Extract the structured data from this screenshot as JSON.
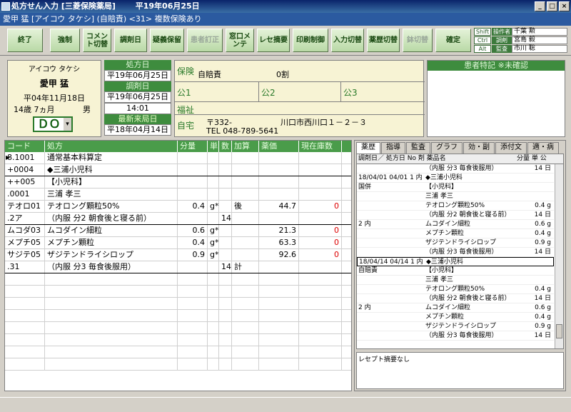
{
  "window": {
    "title": "処方せん入力 [三菱保険薬局]",
    "date": "平19年06月25日",
    "btn_min": "_",
    "btn_max": "□",
    "btn_close": "×"
  },
  "info_bar": "愛甲 猛 [アイコウ タケシ] (自賠責) <31> 複数保険あり",
  "toolbar": [
    {
      "label": "終了",
      "enabled": true
    },
    {
      "label": "強制",
      "enabled": true
    },
    {
      "label": "コメント切替",
      "enabled": true
    },
    {
      "label": "調剤日",
      "enabled": true
    },
    {
      "label": "疑義保留",
      "enabled": true
    },
    {
      "label": "患者訂正",
      "enabled": false
    },
    {
      "label": "窓口メンテ",
      "enabled": true
    },
    {
      "label": "レセ摘要",
      "enabled": true
    },
    {
      "label": "印刷制御",
      "enabled": true
    },
    {
      "label": "入力切替",
      "enabled": true
    },
    {
      "label": "薬歴切替",
      "enabled": true
    },
    {
      "label": "鉢切替",
      "enabled": false
    },
    {
      "label": "確定",
      "enabled": true
    }
  ],
  "keys": [
    {
      "key": "Shift",
      "name": "操作者",
      "value": "千葉 勲"
    },
    {
      "key": "Ctrl",
      "name": "調剤",
      "value": "宮島 毅"
    },
    {
      "key": "Alt",
      "name": "監査",
      "value": "市川 聡"
    }
  ],
  "patient": {
    "kana": "アイコウ タケシ",
    "name": "愛甲 猛",
    "birth": "平04年11月18日",
    "age": "14歳 7ヵ月",
    "sex": "男",
    "do_label": "ＤＯ",
    "do_arrow": "▾"
  },
  "dates": {
    "rx_label": "処方日",
    "rx_value": "平19年06月25日",
    "disp_label": "調剤日",
    "disp_value": "平19年06月25日",
    "disp_time": "14:01",
    "last_label": "最新来局日",
    "last_value": "平18年04月14日"
  },
  "insurance": {
    "hoken_label": "保険",
    "hoken_value": "自賠責",
    "ratio": "0割",
    "kou1": "公1",
    "kou2": "公2",
    "kou3": "公3",
    "fukushi": "福祉",
    "home_label": "自宅",
    "postal": "〒332-",
    "address": "川口市西川口１－２－３",
    "tel": "TEL 048-789-5641"
  },
  "notes_header": "患者特記 ※未確認",
  "rx_grid": {
    "headers": [
      "コード",
      "処方",
      "分量",
      "単",
      "数",
      "加算",
      "薬価",
      "現在庫数"
    ],
    "rows": [
      {
        "code": "8.1001",
        "name": "通常基本料算定",
        "qty": "",
        "unit": "",
        "n": "",
        "add": "",
        "price": "",
        "stock": "",
        "sep": false
      },
      {
        "code": "+0004",
        "name": "◆三浦小児科",
        "qty": "",
        "unit": "",
        "n": "",
        "add": "",
        "price": "",
        "stock": "",
        "sep": true
      },
      {
        "code": "++005",
        "name": "【小児科】",
        "qty": "",
        "unit": "",
        "n": "",
        "add": "",
        "price": "",
        "stock": "",
        "sep": false
      },
      {
        "code": ".0001",
        "name": "三浦 孝三",
        "qty": "",
        "unit": "",
        "n": "",
        "add": "",
        "price": "",
        "stock": "",
        "sep": false
      },
      {
        "code": "テオロ01",
        "name": "テオロング顆粒50%",
        "qty": "0.4",
        "unit": "g*",
        "n": "",
        "add": "後",
        "price": "44.7",
        "stock": "0",
        "sep": false
      },
      {
        "code": ".2ア",
        "name": "（内服 分2 朝食後と寝る前）",
        "qty": "",
        "unit": "",
        "n": "14",
        "add": "",
        "price": "",
        "stock": "",
        "sep": true
      },
      {
        "code": "ムコダ03",
        "name": "ムコダイン細粒",
        "qty": "0.6",
        "unit": "g*",
        "n": "",
        "add": "",
        "price": "21.3",
        "stock": "0",
        "sep": false
      },
      {
        "code": "メプチ05",
        "name": "メプチン顆粒",
        "qty": "0.4",
        "unit": "g*",
        "n": "",
        "add": "",
        "price": "63.3",
        "stock": "0",
        "sep": false
      },
      {
        "code": "サジテ05",
        "name": "ザジテンドライシロップ",
        "qty": "0.9",
        "unit": "g*",
        "n": "",
        "add": "",
        "price": "92.6",
        "stock": "0",
        "sep": false
      },
      {
        "code": ".31",
        "name": "（内服 分3 毎食後服用）",
        "qty": "",
        "unit": "",
        "n": "14",
        "add": "計",
        "price": "",
        "stock": "",
        "sep": true
      }
    ]
  },
  "history": {
    "tabs": [
      "薬歴",
      "指導",
      "監査",
      "グラフ",
      "効・副",
      "添付文",
      "適・病"
    ],
    "headers": [
      "調剤日／ 処方日 No 剤 薬品名",
      "分量 単 公"
    ],
    "rows": [
      {
        "a": "",
        "b": "（内服 分3 毎食後服用）",
        "c": "14 日",
        "sel": false
      },
      {
        "a": "18/04/01  04/01  1 内",
        "b": "◆三浦小児科",
        "c": "",
        "sel": false
      },
      {
        "a": "国併",
        "b": "【小児科】",
        "c": "",
        "sel": false
      },
      {
        "a": "",
        "b": "三浦 孝三",
        "c": "",
        "sel": false
      },
      {
        "a": "",
        "b": "テオロング顆粒50%",
        "c": "0.4 g",
        "sel": false
      },
      {
        "a": "",
        "b": "（内服 分2 朝食後と寝る前）",
        "c": "14 日",
        "sel": false
      },
      {
        "a": "2 内",
        "b": "ムコダイン細粒",
        "c": "0.6 g",
        "sel": false
      },
      {
        "a": "",
        "b": "メプチン顆粒",
        "c": "0.4 g",
        "sel": false
      },
      {
        "a": "",
        "b": "ザジテンドライシロップ",
        "c": "0.9 g",
        "sel": false
      },
      {
        "a": "",
        "b": "（内服 分3 毎食後服用）",
        "c": "14 日",
        "sel": false
      },
      {
        "a": "18/04/14  04/14  1 内",
        "b": "◆三浦小児科",
        "c": "",
        "sel": true
      },
      {
        "a": "自賠責",
        "b": "【小児科】",
        "c": "",
        "sel": false
      },
      {
        "a": "",
        "b": "三浦 孝三",
        "c": "",
        "sel": false
      },
      {
        "a": "",
        "b": "テオロング顆粒50%",
        "c": "0.4 g",
        "sel": false
      },
      {
        "a": "",
        "b": "（内服 分2 朝食後と寝る前）",
        "c": "14 日",
        "sel": false
      },
      {
        "a": "2 内",
        "b": "ムコダイン細粒",
        "c": "0.6 g",
        "sel": false
      },
      {
        "a": "",
        "b": "メプチン顆粒",
        "c": "0.4 g",
        "sel": false
      },
      {
        "a": "",
        "b": "ザジテンドライシロップ",
        "c": "0.9 g",
        "sel": false
      },
      {
        "a": "",
        "b": "（内服 分3 毎食後服用）",
        "c": "14 日",
        "sel": false
      }
    ],
    "rece_note": "レセプト摘要なし"
  }
}
